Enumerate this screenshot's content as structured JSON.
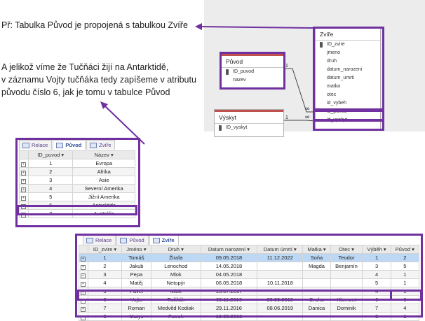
{
  "notes": {
    "line1": "Př: Tabulka Původ je propojená s tabulkou Zvíře",
    "line2": "A jelikož víme že Tučňáci žijí na Antarktidě,",
    "line3": "v záznamu Vojty tučňáka tedy zapíšeme v atributu",
    "line4": "původu číslo 6, jak je tomu v tabulce Původ"
  },
  "diagram": {
    "puvod": {
      "title": "Původ",
      "fields": [
        "ID_puvod",
        "nazev"
      ]
    },
    "zvire": {
      "title": "Zvíře",
      "fields": [
        "ID_zvire",
        "jmeno",
        "druh",
        "datum_narozeni",
        "datum_umrti",
        "matka",
        "otec",
        "id_vybeh",
        "id_puvod",
        "id_vyskyt"
      ]
    },
    "vyskyt": {
      "title": "Výskyt",
      "fields": [
        "ID_vyskyt"
      ]
    },
    "rel_one": "1",
    "rel_many": "∞"
  },
  "puvod_view": {
    "tabs": [
      "Relace",
      "Původ",
      "Zvíře"
    ],
    "headers": [
      "ID_puvod",
      "Název"
    ],
    "rows": [
      [
        "1",
        "Evropa"
      ],
      [
        "2",
        "Afrika"
      ],
      [
        "3",
        "Asie"
      ],
      [
        "4",
        "Severní Amerika"
      ],
      [
        "5",
        "Jižní Amerika"
      ],
      [
        "6",
        "Antarktida"
      ],
      [
        "7",
        "Austrálie"
      ]
    ]
  },
  "zvire_view": {
    "tabs": [
      "Relace",
      "Původ",
      "Zvíře"
    ],
    "headers": [
      "ID_zvire",
      "Jméno",
      "Druh",
      "Datum narození",
      "Datum úmrtí",
      "Matka",
      "Otec",
      "Výběh",
      "Původ"
    ],
    "rows": [
      [
        "1",
        "Tomáš",
        "Žirafa",
        "09.05.2018",
        "11.12.2022",
        "Soňa",
        "Teodor",
        "1",
        "2"
      ],
      [
        "2",
        "Jakub",
        "Lenochod",
        "14.05.2018",
        "",
        "Magda",
        "Benjamín",
        "3",
        "5"
      ],
      [
        "3",
        "Pepa",
        "Mlok",
        "04.05.2018",
        "",
        "",
        "",
        "4",
        "1"
      ],
      [
        "4",
        "Matěj",
        "Netopýr",
        "06.05.2018",
        "10.11.2018",
        "",
        "",
        "5",
        "1"
      ],
      [
        "5",
        "Pavel",
        "Mlok",
        "13.07.2017",
        "",
        "",
        "",
        "4",
        "1"
      ],
      [
        "6",
        "Vojta",
        "Tučňák",
        "09.11.2016",
        "20.09.2019",
        "Draha",
        "Klement",
        "6",
        "6"
      ],
      [
        "7",
        "Roman",
        "Medvěd Kodiak",
        "29.11.2016",
        "08.06.2019",
        "Danica",
        "Dominik",
        "7",
        "4"
      ],
      [
        "8",
        "Matys",
        "Pstruh",
        "12.05.2018",
        "",
        "",
        "",
        "8",
        "1"
      ]
    ]
  },
  "colors": {
    "highlight": "#7030a0",
    "selected_row": "#bcd8f5"
  }
}
